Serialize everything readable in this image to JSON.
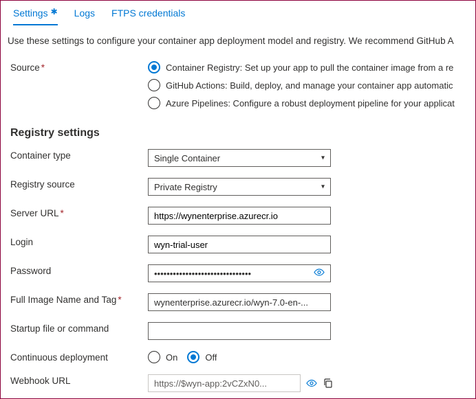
{
  "tabs": {
    "settings": "Settings",
    "logs": "Logs",
    "ftps": "FTPS credentials"
  },
  "intro": "Use these settings to configure your container app deployment model and registry. We recommend GitHub A",
  "source": {
    "label": "Source",
    "opts": {
      "cr": "Container Registry: Set up your app to pull the container image from a re",
      "gh": "GitHub Actions: Build, deploy, and manage your container app automatic",
      "az": "Azure Pipelines: Configure a robust deployment pipeline for your applicat"
    }
  },
  "registry": {
    "head": "Registry settings",
    "containerType": {
      "label": "Container type",
      "value": "Single Container"
    },
    "registrySource": {
      "label": "Registry source",
      "value": "Private Registry"
    },
    "serverUrl": {
      "label": "Server URL",
      "value": "https://wynenterprise.azurecr.io"
    },
    "login": {
      "label": "Login",
      "value": "wyn-trial-user"
    },
    "password": {
      "label": "Password",
      "value": "•••••••••••••••••••••••••••••••"
    },
    "fullImage": {
      "label": "Full Image Name and Tag",
      "value": "wynenterprise.azurecr.io/wyn-7.0-en-..."
    },
    "startup": {
      "label": "Startup file or command",
      "value": ""
    },
    "cd": {
      "label": "Continuous deployment",
      "on": "On",
      "off": "Off"
    },
    "webhook": {
      "label": "Webhook URL",
      "value": "https://$wyn-app:2vCZxN0..."
    }
  }
}
